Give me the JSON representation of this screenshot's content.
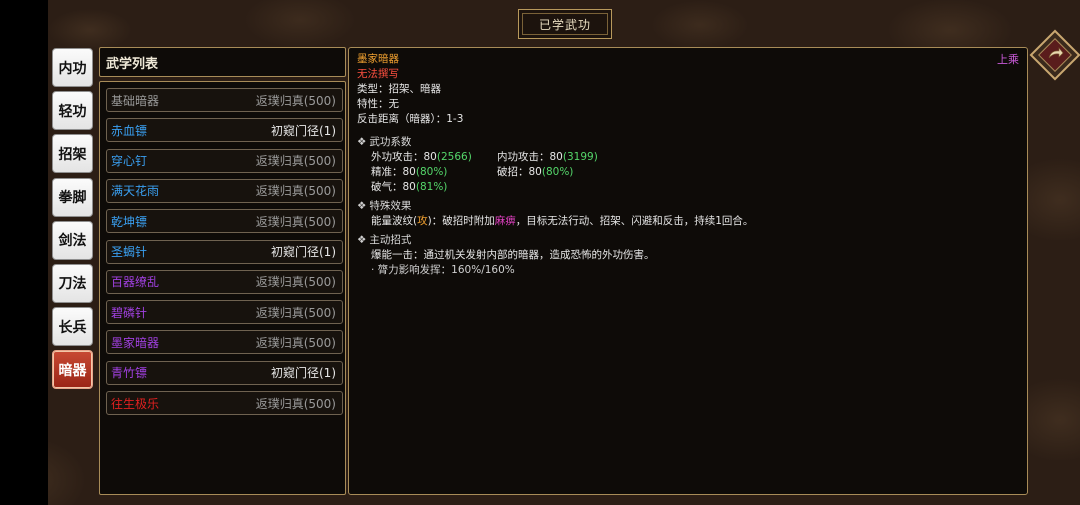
{
  "header": {
    "title": "已学武功"
  },
  "tabs": [
    {
      "label": "内功"
    },
    {
      "label": "轻功"
    },
    {
      "label": "招架"
    },
    {
      "label": "拳脚"
    },
    {
      "label": "剑法"
    },
    {
      "label": "刀法"
    },
    {
      "label": "长兵"
    },
    {
      "label": "暗器",
      "active": true
    }
  ],
  "skill_list": {
    "header": "武学列表",
    "items": [
      {
        "name": "基础暗器",
        "level": "返璞归真(500)",
        "name_color": "#9a9a9a",
        "level_bright": false
      },
      {
        "name": "赤血镖",
        "level": "初窥门径(1)",
        "name_color": "#3a9ff0",
        "level_bright": true
      },
      {
        "name": "穿心钉",
        "level": "返璞归真(500)",
        "name_color": "#3a9ff0",
        "level_bright": false
      },
      {
        "name": "满天花雨",
        "level": "返璞归真(500)",
        "name_color": "#3a9ff0",
        "level_bright": false
      },
      {
        "name": "乾坤镖",
        "level": "返璞归真(500)",
        "name_color": "#3a9ff0",
        "level_bright": false
      },
      {
        "name": "圣蝎针",
        "level": "初窥门径(1)",
        "name_color": "#3a9ff0",
        "level_bright": true
      },
      {
        "name": "百器缭乱",
        "level": "返璞归真(500)",
        "name_color": "#a040e0",
        "level_bright": false
      },
      {
        "name": "碧磷针",
        "level": "返璞归真(500)",
        "name_color": "#a040e0",
        "level_bright": false
      },
      {
        "name": "墨家暗器",
        "level": "返璞归真(500)",
        "name_color": "#a040e0",
        "level_bright": false
      },
      {
        "name": "青竹镖",
        "level": "初窥门径(1)",
        "name_color": "#a040e0",
        "level_bright": true
      },
      {
        "name": "往生极乐",
        "level": "返璞归真(500)",
        "name_color": "#e02020",
        "level_bright": false
      }
    ]
  },
  "detail": {
    "name": "墨家暗器",
    "top_right": "上乘",
    "note": "无法撰写",
    "type": "类型：招架、暗器",
    "trait": "特性：无",
    "range": "反击距离（暗器）：1-3",
    "coef_title": "武功系数",
    "coefs": [
      {
        "label": "外功攻击：80",
        "value": "(2566)"
      },
      {
        "label": "内功攻击：80",
        "value": "(3199)"
      },
      {
        "label": "精准：80",
        "value": "(80%)"
      },
      {
        "label": "破招：80",
        "value": "(80%)"
      },
      {
        "label": "破气：80",
        "value": "(81%)"
      }
    ],
    "special_title": "特殊效果",
    "special_prefix": "能量波纹(",
    "special_tag": "攻",
    "special_mid": ")：破招时附加",
    "special_status": "麻痹",
    "special_suffix": "，目标无法行动、招架、闪避和反击，持续1回合。",
    "active_title": "主动招式",
    "active_desc": "爆能一击：通过机关发射内部的暗器，造成恐怖的外功伤害。",
    "active_scaling": "· 膂力影响发挥：160%/160%"
  },
  "colors": {
    "name_title": "#f0a030",
    "note": "#ff5040",
    "accent_border": "#a88c58",
    "active_tab": "#b8341f"
  }
}
